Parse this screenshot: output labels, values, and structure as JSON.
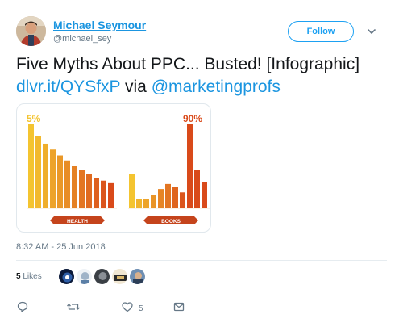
{
  "user": {
    "name": "Michael Seymour",
    "handle": "@michael_sey"
  },
  "follow_button": {
    "label": "Follow"
  },
  "tweet": {
    "text_main": "Five Myths About PPC... Busted! [Infographic]",
    "link": "dlvr.it/QYSfxP",
    "via_text": " via ",
    "mention": "@marketingprofs",
    "timestamp": "8:32 AM - 25 Jun 2018"
  },
  "infographic": {
    "left_value": "5%",
    "right_value": "90%",
    "left_label": "HEALTH",
    "right_label": "BOOKS",
    "left_bar_levels": [
      1.0,
      0.85,
      0.76,
      0.69,
      0.62,
      0.56,
      0.5,
      0.45,
      0.4,
      0.35,
      0.32,
      0.29
    ],
    "right_bar_levels": [
      0.4,
      0.1,
      0.1,
      0.15,
      0.22,
      0.28,
      0.25,
      0.18,
      1.0,
      0.45,
      0.3
    ],
    "colors": {
      "accent_yellow": "#f4c430",
      "accent_red": "#d94a1a",
      "ribbon": "#c5441c"
    }
  },
  "engagement": {
    "likes_count": "5",
    "likes_word": "Likes",
    "like_action_count": "5"
  },
  "icons": [
    "reply-icon",
    "retweet-icon",
    "like-icon",
    "message-icon",
    "chevron-down-icon"
  ],
  "colors": {
    "link": "#1b95e0",
    "secondary_text": "#657786",
    "follow_border": "#1da1f2"
  }
}
